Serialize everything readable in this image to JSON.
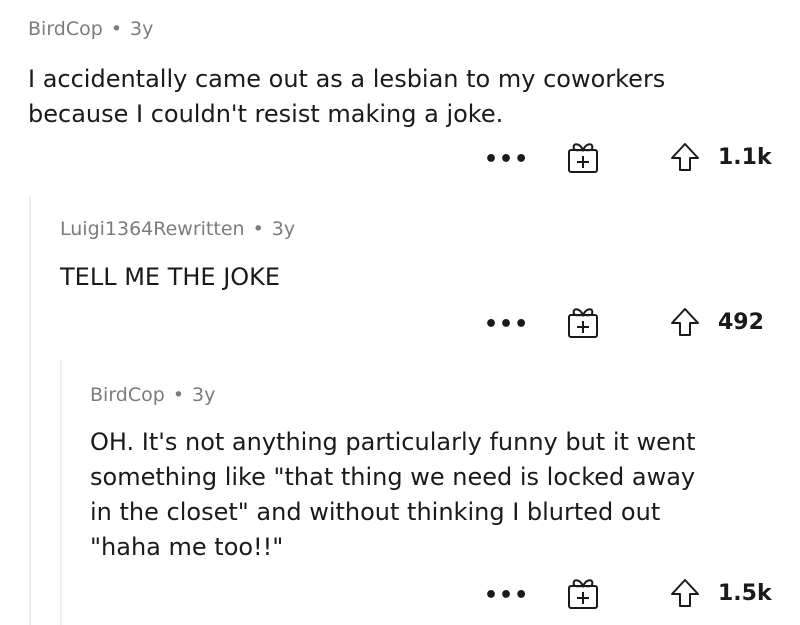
{
  "comments": [
    {
      "author": "BirdCop",
      "age": "3y",
      "text_lines": [
        "I accidentally came out as a lesbian to my coworkers",
        "because I couldn't resist making a joke."
      ],
      "more_label": "•••",
      "score": "1.1k"
    },
    {
      "author": "Luigi1364Rewritten",
      "age": "3y",
      "text_lines": [
        "TELL ME THE JOKE"
      ],
      "more_label": "•••",
      "score": "492"
    },
    {
      "author": "BirdCop",
      "age": "3y",
      "text_lines": [
        "OH. It's not anything particularly funny but it went",
        "something like \"that thing we need is locked away",
        "in the closet\" and without thinking I blurted out",
        "\"haha me too!!\""
      ],
      "more_label": "•••",
      "score": "1.5k"
    }
  ],
  "meta_separator": "•",
  "icons": {
    "more": "more-options-icon",
    "award": "gift-icon",
    "upvote": "upvote-arrow-icon"
  }
}
